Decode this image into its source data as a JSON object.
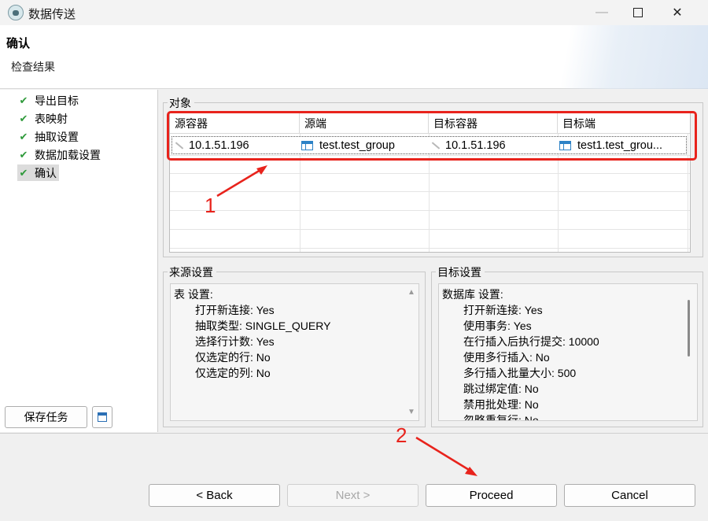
{
  "window": {
    "title": "数据传送"
  },
  "header": {
    "title": "确认",
    "subtitle": "检查结果"
  },
  "steps": [
    {
      "label": "导出目标"
    },
    {
      "label": "表映射"
    },
    {
      "label": "抽取设置"
    },
    {
      "label": "数据加载设置"
    },
    {
      "label": "确认"
    }
  ],
  "left_actions": {
    "save_task": "保存任务"
  },
  "objects": {
    "group_label": "对象",
    "columns": [
      "源容器",
      "源端",
      "目标容器",
      "目标端"
    ],
    "rows": [
      {
        "source_container": "10.1.51.196",
        "source": "test.test_group",
        "target_container": "10.1.51.196",
        "target": "test1.test_grou..."
      }
    ]
  },
  "source_settings": {
    "group_label": "来源设置",
    "heading": "表 设置:",
    "items": [
      "打开新连接: Yes",
      "抽取类型: SINGLE_QUERY",
      "选择行计数: Yes",
      "仅选定的行: No",
      "仅选定的列: No"
    ]
  },
  "target_settings": {
    "group_label": "目标设置",
    "heading": "数据库 设置:",
    "items": [
      "打开新连接: Yes",
      "使用事务: Yes",
      "在行插入后执行提交: 10000",
      "使用多行插入: No",
      "多行插入批量大小: 500",
      "跳过绑定值: No",
      "禁用批处理: No",
      "忽略重复行: No"
    ]
  },
  "annotations": [
    "1",
    "2"
  ],
  "nav": {
    "back": "< Back",
    "next": "Next >",
    "proceed": "Proceed",
    "cancel": "Cancel"
  },
  "colors": {
    "accent_red": "#e8231c",
    "check_green": "#2f9a3b",
    "table_icon_blue": "#2d82c6"
  }
}
